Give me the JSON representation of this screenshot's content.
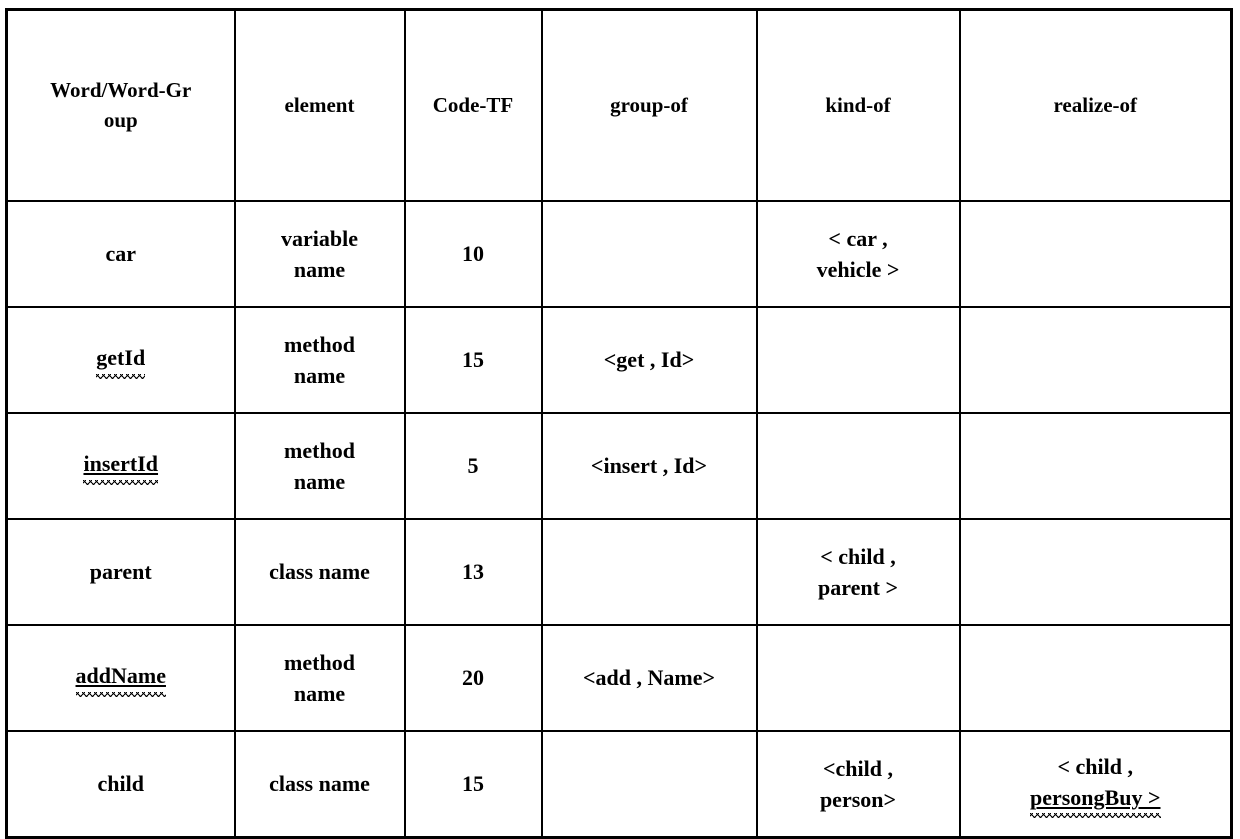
{
  "table": {
    "columns": [
      {
        "key": "word",
        "label": "Word/Word-Group"
      },
      {
        "key": "element",
        "label": "element"
      },
      {
        "key": "code_tf",
        "label": "Code-TF"
      },
      {
        "key": "group_of",
        "label": "group-of"
      },
      {
        "key": "kind_of",
        "label": "kind-of"
      },
      {
        "key": "realize_of",
        "label": "realize-of"
      }
    ],
    "header": {
      "word_line1": "Word/Word-Gr",
      "word_line2": "oup",
      "element": "element",
      "code_tf": "Code-TF",
      "group_of": "group-of",
      "kind_of": "kind-of",
      "realize_of": "realize-of"
    },
    "rows": [
      {
        "word": "car",
        "word_misspelled": false,
        "element_line1": "variable",
        "element_line2": "name",
        "code_tf": "10",
        "group_of": "",
        "kind_of_line1": "< car ,",
        "kind_of_line2": "vehicle >",
        "realize_of_line1": "",
        "realize_of_line2": ""
      },
      {
        "word": "getId",
        "word_misspelled": true,
        "element_line1": "method",
        "element_line2": "name",
        "code_tf": "15",
        "group_of": "<get , Id>",
        "kind_of_line1": "",
        "kind_of_line2": "",
        "realize_of_line1": "",
        "realize_of_line2": ""
      },
      {
        "word": "insertId",
        "word_misspelled": true,
        "element_line1": "method",
        "element_line2": "name",
        "code_tf": "5",
        "group_of": "<insert , Id>",
        "kind_of_line1": "",
        "kind_of_line2": "",
        "realize_of_line1": "",
        "realize_of_line2": ""
      },
      {
        "word": "parent",
        "word_misspelled": false,
        "element_line1": "class name",
        "element_line2": "",
        "code_tf": "13",
        "group_of": "",
        "kind_of_line1": "< child ,",
        "kind_of_line2": "parent >",
        "realize_of_line1": "",
        "realize_of_line2": ""
      },
      {
        "word": "addName",
        "word_misspelled": true,
        "element_line1": "method",
        "element_line2": "name",
        "code_tf": "20",
        "group_of": "<add , Name>",
        "kind_of_line1": "",
        "kind_of_line2": "",
        "realize_of_line1": "",
        "realize_of_line2": ""
      },
      {
        "word": "child",
        "word_misspelled": false,
        "element_line1": "class name",
        "element_line2": "",
        "code_tf": "15",
        "group_of": "",
        "kind_of_line1": "<child ,",
        "kind_of_line2": "person>",
        "realize_of_line1": "< child ,",
        "realize_of_line2": "persongBuy >",
        "realize_of_misspelled": true
      }
    ]
  },
  "colors": {
    "border": "#000000",
    "text": "#000000",
    "background": "#ffffff",
    "spellcheck_underline": "#000000"
  }
}
